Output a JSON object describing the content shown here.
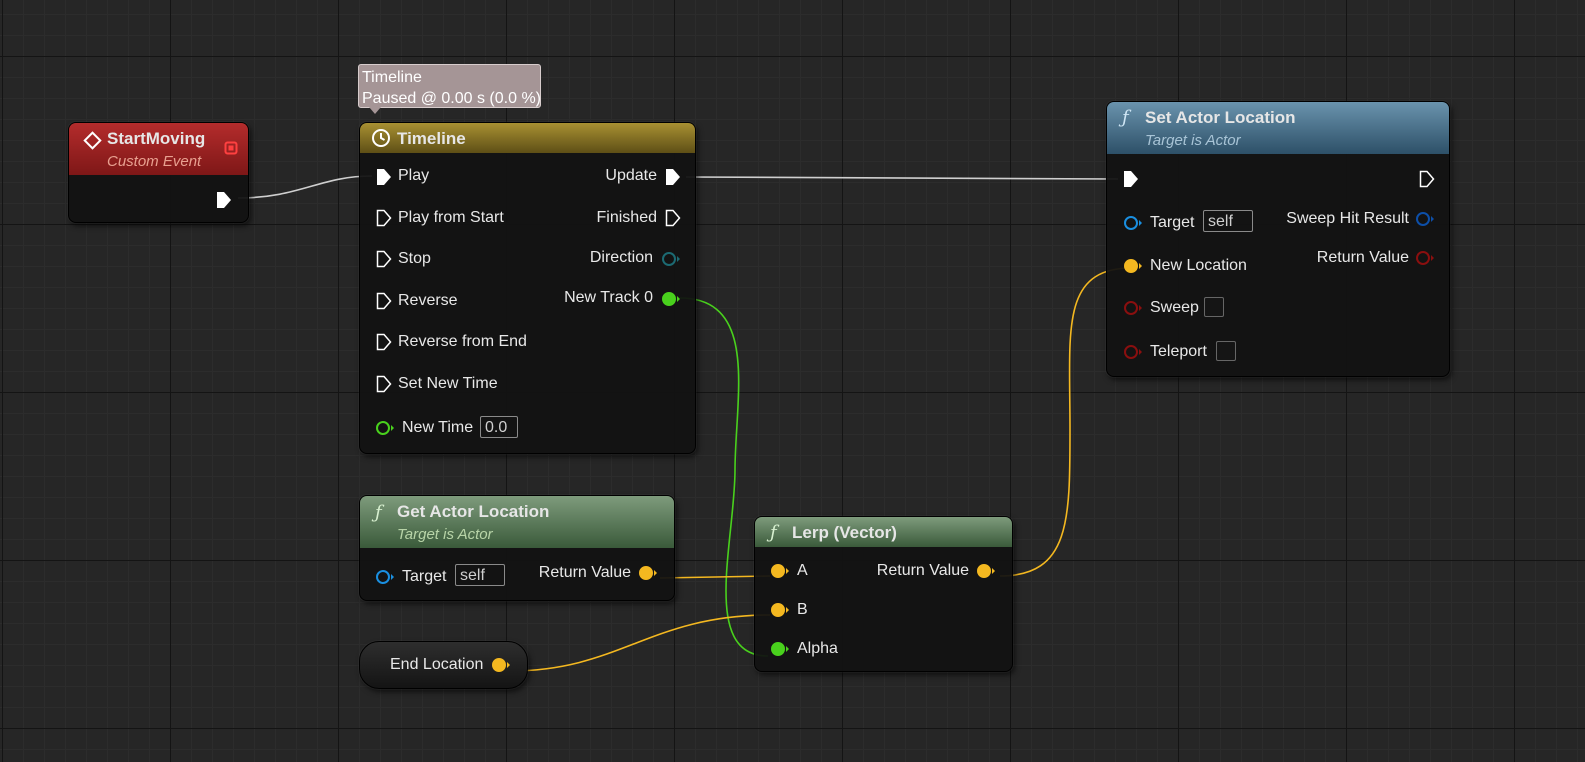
{
  "colors": {
    "exec": "#ffffff",
    "vector": "#f4b820",
    "float": "#49d11d",
    "object": "#1a8fe0",
    "struct": "#0d4fa8",
    "bool": "#8a0f0f",
    "direction": "#1c6a72",
    "event_header": "#8e1a1a",
    "timeline_header": "#7a6a1c",
    "pure_header": "#587a58",
    "call_header": "#3c6780"
  },
  "tooltip": {
    "line1": "Timeline",
    "line2": "Paused @ 0.00 s (0.0 %)"
  },
  "start_moving": {
    "title": "StartMoving",
    "subtitle": "Custom Event",
    "icon": "event-diamond-icon"
  },
  "timeline": {
    "title": "Timeline",
    "icon": "clock-icon",
    "inputs": [
      "Play",
      "Play from Start",
      "Stop",
      "Reverse",
      "Reverse from End",
      "Set New Time"
    ],
    "outputs": [
      "Update",
      "Finished",
      "Direction",
      "New Track 0"
    ],
    "new_time_label": "New Time",
    "new_time_value": "0.0"
  },
  "get_actor_location": {
    "title": "Get Actor Location",
    "subtitle": "Target is Actor",
    "glyph": "ƒ",
    "target_label": "Target",
    "target_value": "self",
    "return_label": "Return Value"
  },
  "end_location": {
    "label": "End Location"
  },
  "lerp": {
    "title": "Lerp (Vector)",
    "glyph": "ƒ",
    "inputs": [
      "A",
      "B",
      "Alpha"
    ],
    "return_label": "Return Value"
  },
  "set_actor_location": {
    "title": "Set Actor Location",
    "subtitle": "Target is Actor",
    "glyph": "ƒ",
    "target_label": "Target",
    "target_value": "self",
    "new_location_label": "New Location",
    "sweep_label": "Sweep",
    "teleport_label": "Teleport",
    "sweep_hit_label": "Sweep Hit Result",
    "return_label": "Return Value"
  }
}
